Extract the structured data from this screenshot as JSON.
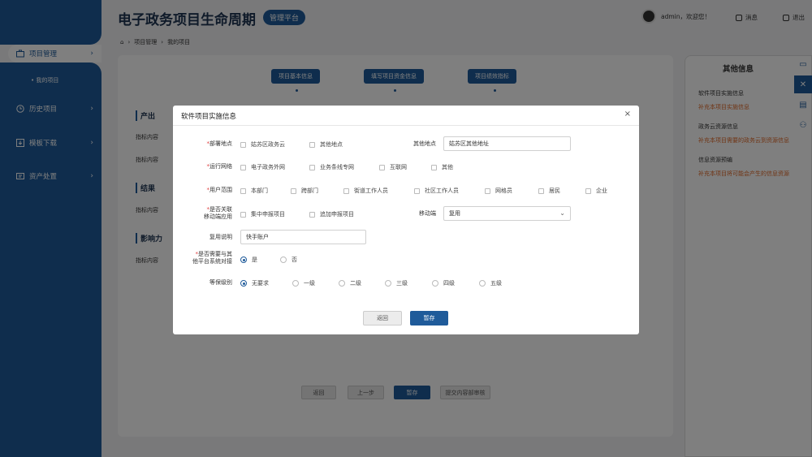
{
  "app": {
    "title": "电子政务项目生命周期",
    "badge": "管理平台",
    "user": "admin，欢迎您！",
    "messages": "消息",
    "logout": "退出"
  },
  "sidebar": {
    "items": [
      {
        "label": "项目管理",
        "icon": "briefcase-icon"
      },
      {
        "label": "历史项目",
        "icon": "clock-icon"
      },
      {
        "label": "模板下载",
        "icon": "download-icon"
      },
      {
        "label": "资产处置",
        "icon": "asset-icon"
      }
    ],
    "sub_item": "• 我的项目"
  },
  "breadcrumb": [
    "项目管理",
    "我的项目"
  ],
  "steps": [
    "项目基本信息",
    "填写项目资金信息",
    "项目绩效指标"
  ],
  "sections": {
    "output": "产出",
    "result": "结果",
    "impact": "影响力",
    "indicator_label": "指标内容"
  },
  "bottom_buttons": {
    "back": "返回",
    "prev": "上一步",
    "save": "暂存",
    "submit": "提交内容部审核"
  },
  "right_panel": {
    "title": "其他信息",
    "groups": [
      {
        "heading": "软件项目实施信息",
        "text": "补充本项目实施信息"
      },
      {
        "heading": "政务云资源信息",
        "text": "补充本项目需要的政务云到资源信息"
      },
      {
        "heading": "信息资源预编",
        "text": "补充本项目将可能会产生的信息资源"
      }
    ]
  },
  "modal": {
    "title": "软件项目实施信息",
    "deploy_location": {
      "label": "部署地点",
      "options": [
        "姑苏区政务云",
        "其他地点"
      ],
      "other_label": "其他地点",
      "other_value": "姑苏区其他地址"
    },
    "network": {
      "label": "运行网络",
      "options": [
        "电子政务外网",
        "业务条线专网",
        "互联网",
        "其他"
      ]
    },
    "users": {
      "label": "用户范围",
      "options": [
        "本部门",
        "跨部门",
        "街道工作人员",
        "社区工作人员",
        "网格员",
        "居民",
        "企业"
      ]
    },
    "mobile": {
      "label_line1": "是否关联",
      "label_line2": "移动端应用",
      "options": [
        "集中申报项目",
        "追加申报项目"
      ],
      "mobile_label": "移动端",
      "mobile_value": "复用"
    },
    "reuse": {
      "label": "复用说明",
      "value": "快手账户"
    },
    "dock": {
      "label_line1": "是否需要与其",
      "label_line2": "他平台系统对接",
      "options": [
        "是",
        "否"
      ],
      "selected": "是"
    },
    "protection": {
      "label": "等保级别",
      "options": [
        "无要求",
        "一级",
        "二级",
        "三级",
        "四级",
        "五级"
      ],
      "selected": "无要求"
    },
    "back": "返回",
    "save": "暂存"
  }
}
